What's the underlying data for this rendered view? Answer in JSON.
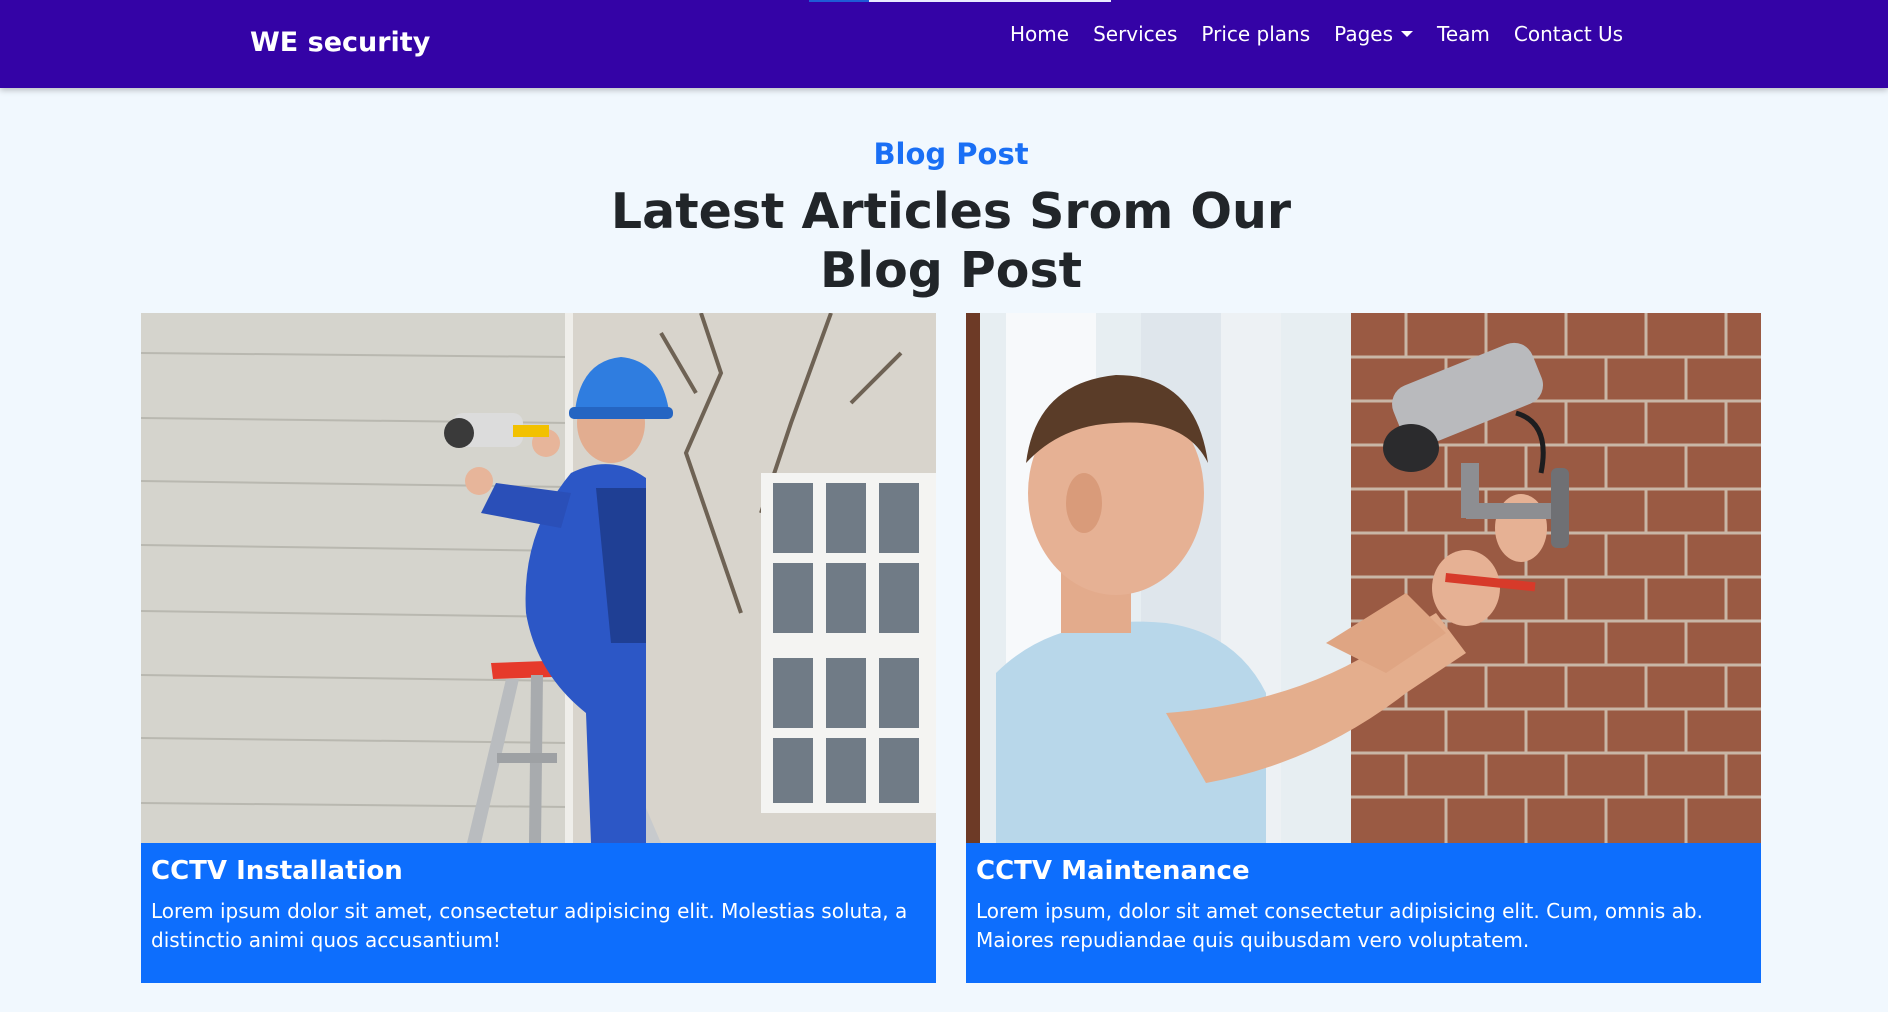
{
  "navbar": {
    "brand": "WE security",
    "links": [
      {
        "label": "Home"
      },
      {
        "label": "Services"
      },
      {
        "label": "Price plans"
      },
      {
        "label": "Pages",
        "has_dropdown": true,
        "icon": "caret-down-icon"
      },
      {
        "label": "Team"
      },
      {
        "label": "Contact Us"
      }
    ]
  },
  "section": {
    "eyebrow": "Blog Post",
    "heading_line1": "Latest Articles Srom Our",
    "heading_line2": "Blog Post"
  },
  "cards": [
    {
      "title": "CCTV Installation",
      "text": "Lorem ipsum dolor sit amet, consectetur adipisicing elit. Molestias soluta, a distinctio animi quos accusantium!",
      "image": "photo-technician-on-ladder-installing-cctv-camera"
    },
    {
      "title": "CCTV Maintenance",
      "text": "Lorem ipsum, dolor sit amet consectetur adipisicing elit. Cum, omnis ab. Maiores repudiandae quis quibusdam vero voluptatem.",
      "image": "photo-man-adjusting-cctv-camera-on-brick-wall"
    }
  ],
  "colors": {
    "navbar_bg": "#3403a6",
    "page_bg": "#f1f8fe",
    "accent": "#1a6ff5",
    "card_body_bg": "#0d6efd",
    "heading_text": "#212529"
  }
}
